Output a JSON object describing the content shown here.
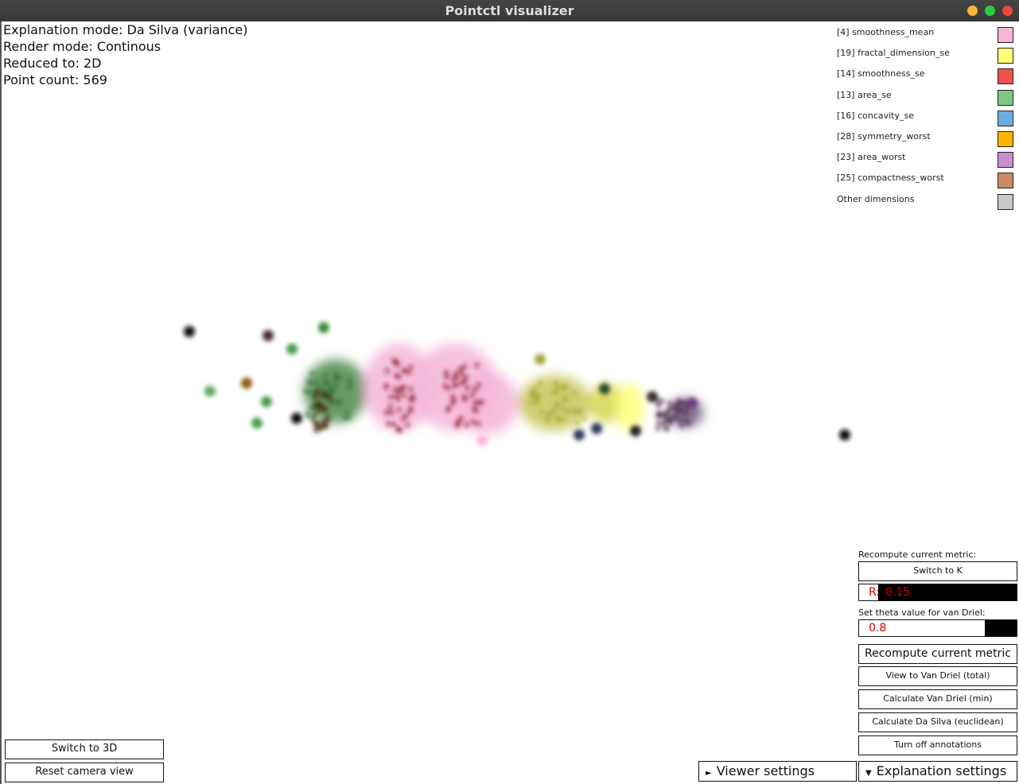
{
  "window": {
    "title": "Pointctl visualizer",
    "controls": [
      {
        "name": "minimize-button",
        "color": "#f6b73c"
      },
      {
        "name": "maximize-button",
        "color": "#2ecc40"
      },
      {
        "name": "close-button",
        "color": "#e74c3c"
      }
    ]
  },
  "info": {
    "explanation_mode": "Explanation mode: Da Silva (variance)",
    "render_mode": "Render mode: Continous",
    "reduced_to": "Reduced to: 2D",
    "point_count": "Point count: 569"
  },
  "legend": [
    {
      "label": "[4] smoothness_mean",
      "color": "#f4b6d8"
    },
    {
      "label": "[19] fractal_dimension_se",
      "color": "#ffff7a"
    },
    {
      "label": "[14] smoothness_se",
      "color": "#ef5350"
    },
    {
      "label": "[13] area_se",
      "color": "#81c784"
    },
    {
      "label": "[16] concavity_se",
      "color": "#6aaee0"
    },
    {
      "label": "[28] symmetry_worst",
      "color": "#ffb300"
    },
    {
      "label": "[23] area_worst",
      "color": "#c690d0"
    },
    {
      "label": "[25] compactness_worst",
      "color": "#c98c63"
    },
    {
      "label": "Other dimensions",
      "color": "#c8c8c8"
    }
  ],
  "panel": {
    "recompute_caption": "Recompute current metric:",
    "switch_to_k": "Switch to K",
    "r_input": {
      "prefix": "R:",
      "value": "0.15",
      "fill": 0.12
    },
    "theta_caption": "Set theta value for van Driel:",
    "theta_input": {
      "value": "0.8",
      "fill": 0.8
    },
    "recompute_button": "Recompute current metric",
    "view_van_driel": "View to Van Driel (total)",
    "calc_van_driel": "Calculate Van Driel (min)",
    "calc_da_silva": "Calculate Da Silva (euclidean)",
    "turn_off_annotations": "Turn off annotations"
  },
  "bottom": {
    "switch_3d": "Switch to 3D",
    "reset_camera": "Reset camera view",
    "viewer_settings": "Viewer settings",
    "explanation_settings": "Explanation settings"
  }
}
